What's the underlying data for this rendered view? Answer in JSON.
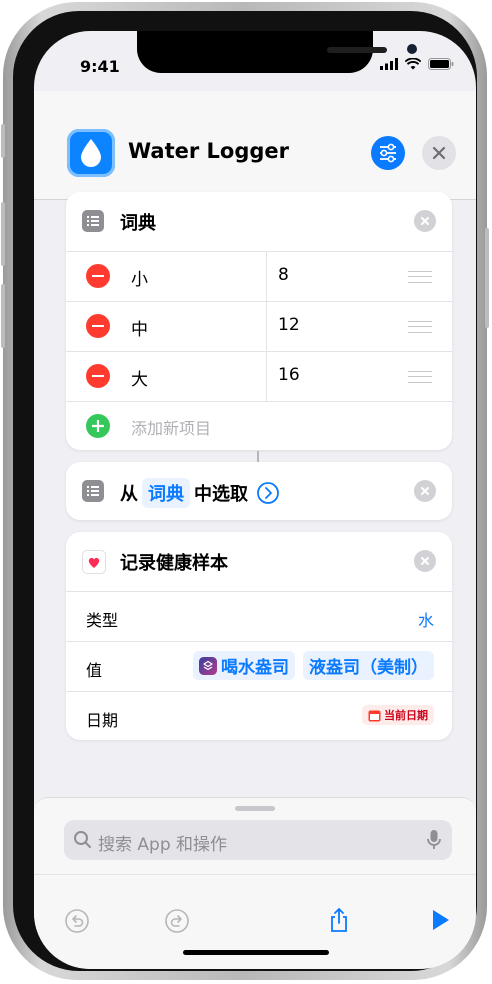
{
  "status": {
    "time": "9:41"
  },
  "header": {
    "title": "Water Logger"
  },
  "dictionary": {
    "title": "词典",
    "rows": [
      {
        "key": "小",
        "value": "8"
      },
      {
        "key": "中",
        "value": "12"
      },
      {
        "key": "大",
        "value": "16"
      }
    ],
    "add_label": "添加新项目"
  },
  "choose": {
    "prefix": "从",
    "token": "词典",
    "suffix": "中选取"
  },
  "health": {
    "title": "记录健康样本",
    "type_label": "类型",
    "type_value": "水",
    "value_label": "值",
    "value_token1": "喝水盎司",
    "value_token2": "液盎司（美制）",
    "date_label": "日期",
    "date_value": "当前日期"
  },
  "search": {
    "placeholder": "搜索 App 和操作"
  },
  "colors": {
    "accent": "#0a7aff",
    "delete": "#ff3b30",
    "add": "#34c759"
  },
  "icons": [
    "water-drop-icon",
    "settings-sliders-icon",
    "close-icon",
    "list-icon",
    "chevron-right-circle-icon",
    "health-heart-icon",
    "shortcut-icon",
    "calendar-icon",
    "search-icon",
    "microphone-icon",
    "undo-icon",
    "redo-icon",
    "share-icon",
    "play-icon"
  ]
}
